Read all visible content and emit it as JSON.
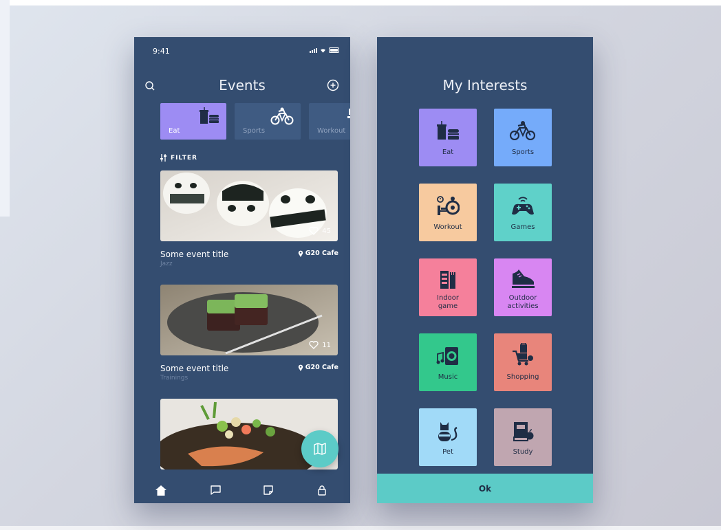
{
  "colors": {
    "accent": "#5ccbc7",
    "panel": "#344d70",
    "dark_text": "#1f2d45"
  },
  "events_screen": {
    "status_time": "9:41",
    "title": "Events",
    "categories": [
      {
        "label": "Eat",
        "color": "#9d8cf3",
        "icon": "food-icon"
      },
      {
        "label": "Sports",
        "color": "#3f5b82",
        "icon": "bicycle-icon"
      },
      {
        "label": "Workout",
        "color": "#3f5b82",
        "icon": "workout-icon"
      }
    ],
    "filter_label": "FILTER",
    "events": [
      {
        "title": "Some event title",
        "subtitle": "Jazz",
        "location": "G20 Cafe",
        "likes": "45",
        "image": "panda-rice-balls"
      },
      {
        "title": "Some event title",
        "subtitle": "Trainings",
        "location": "G20 Cafe",
        "likes": "11",
        "image": "green-dessert"
      },
      {
        "title": "",
        "subtitle": "",
        "location": "",
        "likes": "",
        "image": "salmon-dish"
      }
    ],
    "nav": [
      "home-icon",
      "chat-icon",
      "bookmark-icon",
      "lock-icon"
    ]
  },
  "interests_screen": {
    "title": "My Interests",
    "tiles": [
      {
        "label": "Eat",
        "color": "#9d8cf3",
        "icon": "food-icon"
      },
      {
        "label": "Sports",
        "color": "#75abfa",
        "icon": "bicycle-icon"
      },
      {
        "label": "Workout",
        "color": "#f7ca9f",
        "icon": "workout-icon"
      },
      {
        "label": "Games",
        "color": "#5fd1c9",
        "icon": "gamepad-icon"
      },
      {
        "label": "Indoor\ngame",
        "color": "#f5809b",
        "icon": "indoor-game-icon"
      },
      {
        "label": "Outdoor\nactivities",
        "color": "#d886f2",
        "icon": "sneaker-icon"
      },
      {
        "label": "Music",
        "color": "#33c88c",
        "icon": "music-icon"
      },
      {
        "label": "Shopping",
        "color": "#e8857b",
        "icon": "shopping-cart-icon"
      },
      {
        "label": "Pet",
        "color": "#a1daf8",
        "icon": "cat-icon"
      },
      {
        "label": "Study",
        "color": "#c0a6b0",
        "icon": "book-icon"
      }
    ],
    "ok_label": "Ok"
  }
}
